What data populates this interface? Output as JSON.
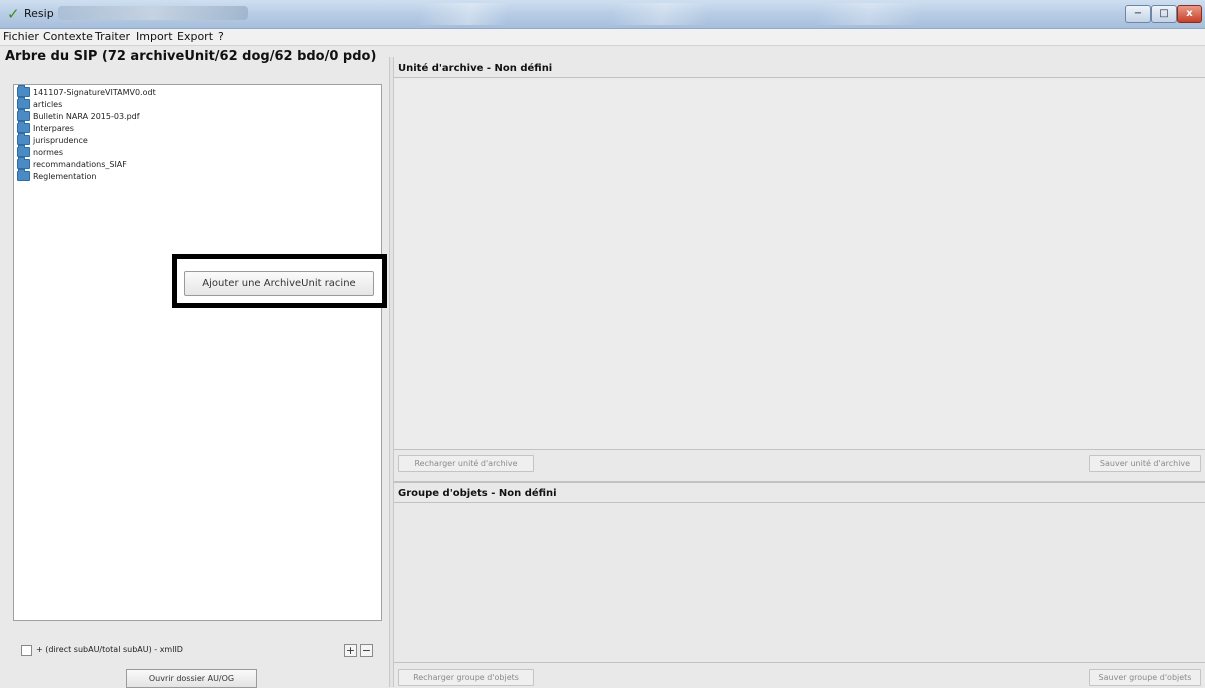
{
  "window": {
    "title": "Resip",
    "check_icon": "check-icon",
    "controls": {
      "minimize": "−",
      "maximize": "□",
      "close": "x"
    }
  },
  "menu": {
    "items": [
      "Fichier",
      "Contexte",
      "Traiter",
      "Import",
      "Export",
      "?"
    ]
  },
  "tree": {
    "title": "Arbre du SIP (72 archiveUnit/62 dog/62 bdo/0 pdo)",
    "items": [
      "141107-SignatureVITAMV0.odt",
      "articles",
      "Bulletin NARA 2015-03.pdf",
      "Interpares",
      "jurisprudence",
      "normes",
      "recommandations_SIAF",
      "Reglementation"
    ],
    "folder_color": "#4a8bc6",
    "add_root_label": "Ajouter une ArchiveUnit racine",
    "checkbox_label": "+ (direct subAU/total subAU) - xmlID",
    "plus_label": "+",
    "minus_label": "−",
    "open_folder_label": "Ouvrir dossier AU/OG"
  },
  "archive_unit": {
    "title": "Unité d'archive - Non défini",
    "reload_label": "Recharger unité d'archive",
    "save_label": "Sauver unité d'archive"
  },
  "object_group": {
    "title": "Groupe d'objets - Non défini",
    "reload_label": "Recharger groupe d'objets",
    "save_label": "Sauver groupe d'objets"
  }
}
